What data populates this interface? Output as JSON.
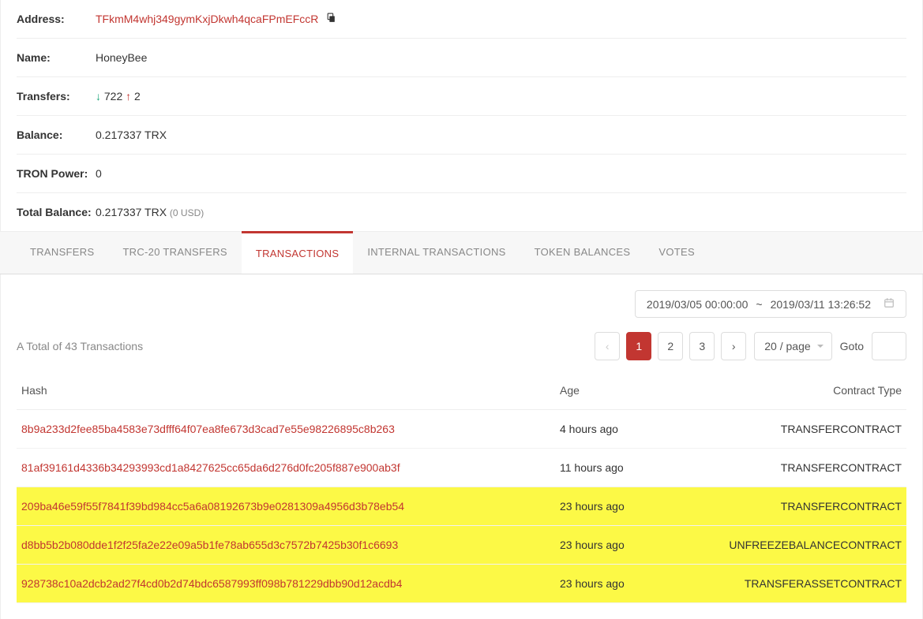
{
  "details": {
    "labels": {
      "address": "Address:",
      "name": "Name:",
      "transfers": "Transfers:",
      "balance": "Balance:",
      "tron_power": "TRON Power:",
      "total_balance": "Total Balance:"
    },
    "address": "TFkmM4whj349gymKxjDkwh4qcaFPmEFccR",
    "name": "HoneyBee",
    "transfers_in": "722",
    "transfers_out": "2",
    "balance": "0.217337 TRX",
    "tron_power": "0",
    "total_balance_main": "0.217337 TRX",
    "total_balance_usd": "(0 USD)"
  },
  "tabs": [
    {
      "label": "TRANSFERS",
      "active": false
    },
    {
      "label": "TRC-20 TRANSFERS",
      "active": false
    },
    {
      "label": "TRANSACTIONS",
      "active": true
    },
    {
      "label": "INTERNAL TRANSACTIONS",
      "active": false
    },
    {
      "label": "TOKEN BALANCES",
      "active": false
    },
    {
      "label": "VOTES",
      "active": false
    }
  ],
  "date_range": {
    "from": "2019/03/05 00:00:00",
    "sep": "~",
    "to": "2019/03/11 13:26:52"
  },
  "summary": {
    "total_text": "A Total of 43 Transactions",
    "pages": [
      "1",
      "2",
      "3"
    ],
    "active_page": "1",
    "page_size": "20 / page",
    "goto_label": "Goto"
  },
  "table": {
    "headers": {
      "hash": "Hash",
      "age": "Age",
      "contract_type": "Contract Type"
    },
    "rows": [
      {
        "hash": "8b9a233d2fee85ba4583e73dfff64f07ea8fe673d3cad7e55e98226895c8b263",
        "age": "4 hours ago",
        "contract": "TRANSFERCONTRACT",
        "highlight": false
      },
      {
        "hash": "81af39161d4336b34293993cd1a8427625cc65da6d276d0fc205f887e900ab3f",
        "age": "11 hours ago",
        "contract": "TRANSFERCONTRACT",
        "highlight": false
      },
      {
        "hash": "209ba46e59f55f7841f39bd984cc5a6a08192673b9e0281309a4956d3b78eb54",
        "age": "23 hours ago",
        "contract": "TRANSFERCONTRACT",
        "highlight": true
      },
      {
        "hash": "d8bb5b2b080dde1f2f25fa2e22e09a5b1fe78ab655d3c7572b7425b30f1c6693",
        "age": "23 hours ago",
        "contract": "UNFREEZEBALANCECONTRACT",
        "highlight": true
      },
      {
        "hash": "928738c10a2dcb2ad27f4cd0b2d74bdc6587993ff098b781229dbb90d12acdb4",
        "age": "23 hours ago",
        "contract": "TRANSFERASSETCONTRACT",
        "highlight": true
      }
    ]
  }
}
